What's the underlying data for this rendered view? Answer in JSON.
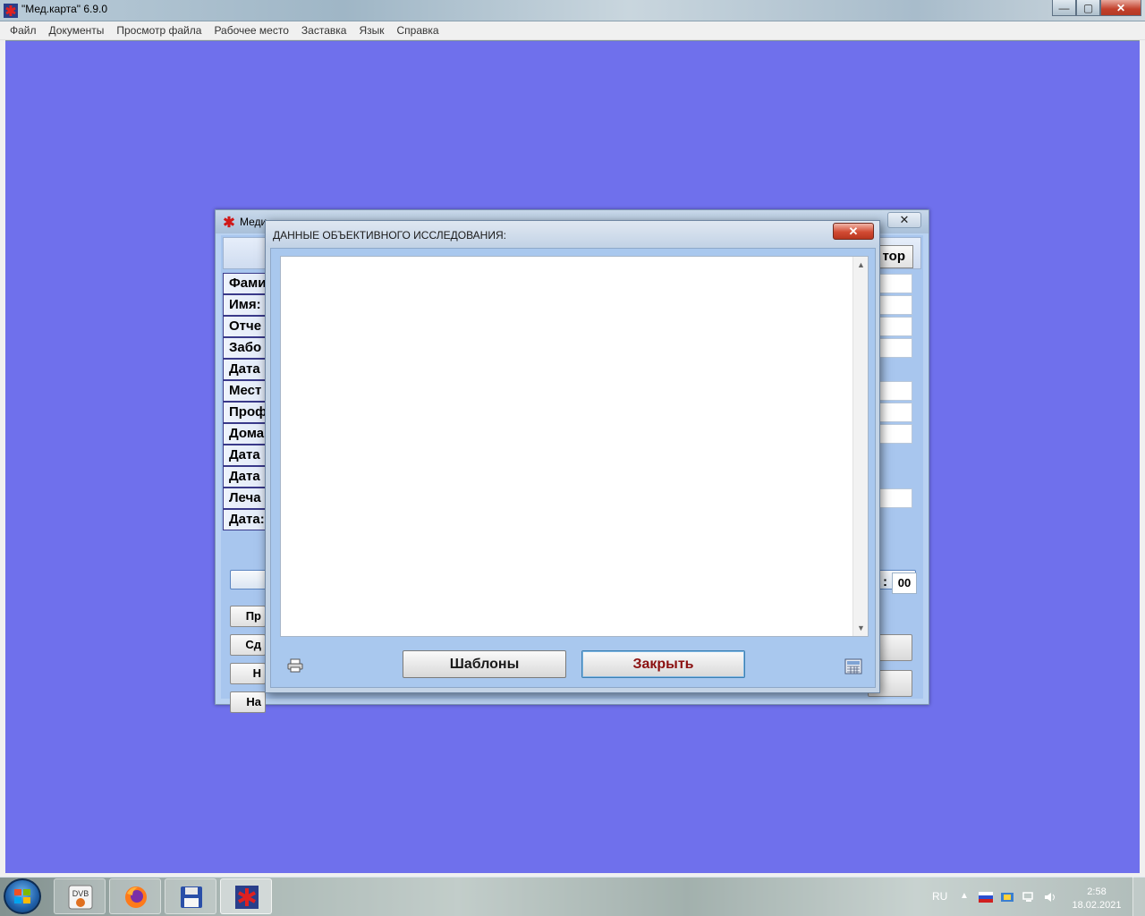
{
  "app": {
    "title": "\"Мед.карта\" 6.9.0",
    "minimize_glyph": "—",
    "restore_glyph": "▢",
    "close_glyph": "✕"
  },
  "menu": [
    "Файл",
    "Документы",
    "Просмотр файла",
    "Рабочее место",
    "Заставка",
    "Язык",
    "Справка"
  ],
  "child_window": {
    "title": "Меди",
    "close_glyph": "✕",
    "doctor_button": "тор",
    "labels": [
      "Фами",
      "Имя:",
      "Отче",
      "Забо",
      "Дата",
      "Мест",
      "Проф",
      "Дома",
      "Дата",
      "Дата",
      "Леча",
      "Дата:"
    ],
    "buttons": [
      "Пр",
      "Сд",
      "Н",
      "На"
    ],
    "time_colon": ":",
    "minutes": "00"
  },
  "dialog": {
    "title": "ДАННЫЕ ОБЪЕКТИВНОГО ИССЛЕДОВАНИЯ:",
    "close_glyph": "✕",
    "memo_text": "",
    "templates_button": "Шаблоны",
    "close_button": "Закрыть",
    "print_icon": "printer-icon",
    "calc_icon": "calculator-icon"
  },
  "taskbar": {
    "apps": [
      "dvb-icon",
      "firefox-icon",
      "floppy-save-icon",
      "medkarta-icon"
    ],
    "language": "RU",
    "time": "2:58",
    "date": "18.02.2021"
  },
  "colors": {
    "desktop_client": "#6f70ec",
    "panel": "#a8c6ee",
    "close_text": "#8b1010"
  }
}
